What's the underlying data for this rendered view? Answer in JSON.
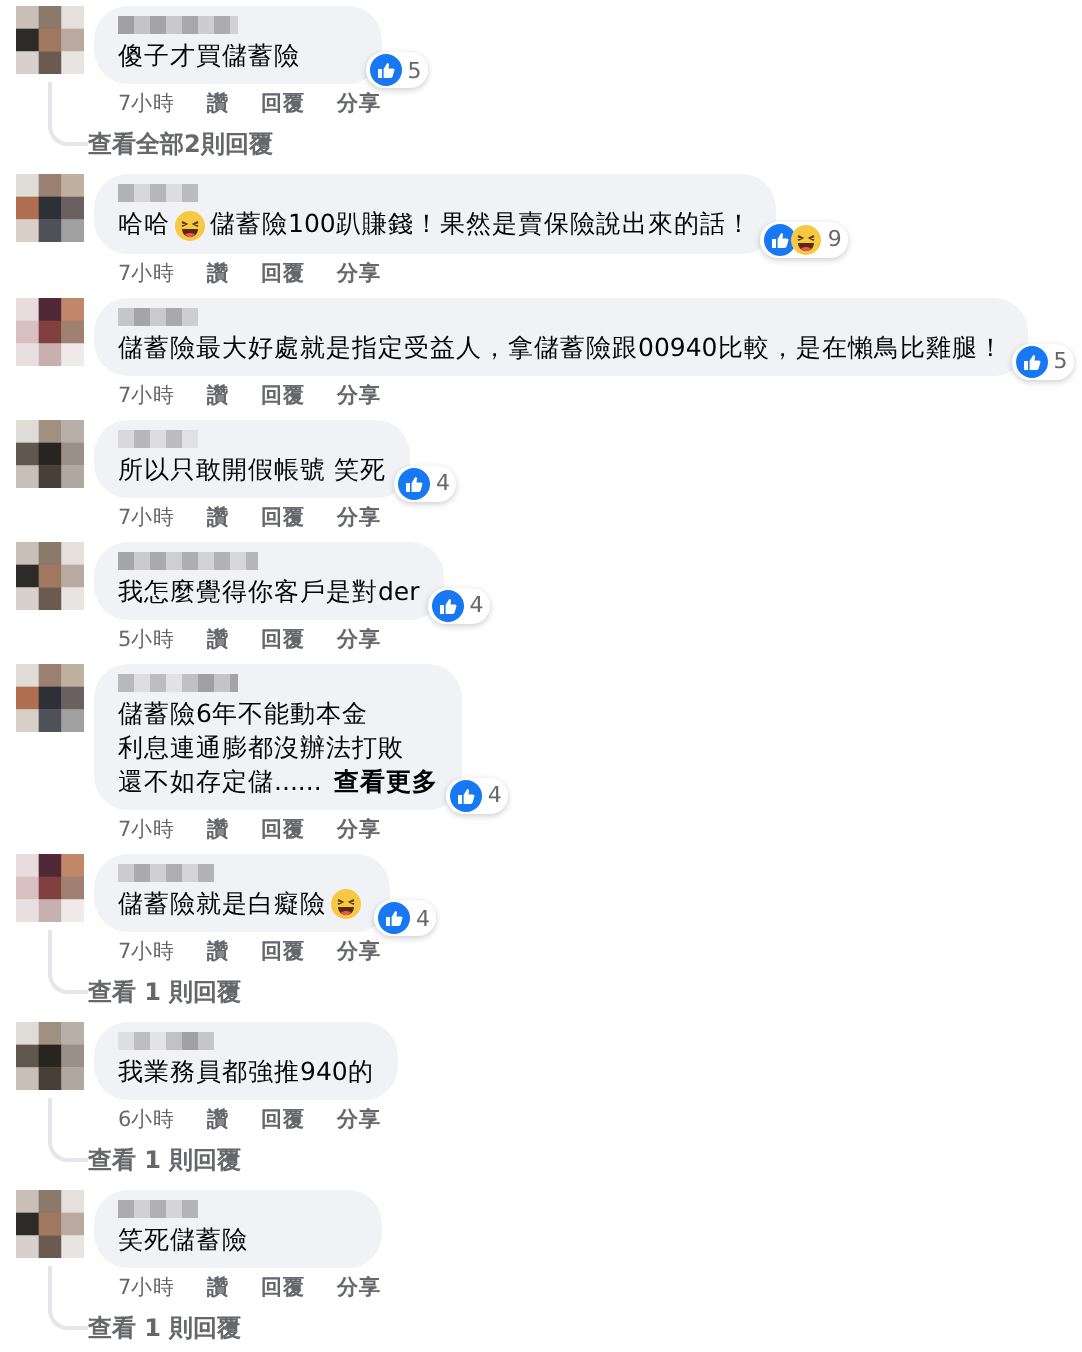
{
  "comments": [
    {
      "body": [
        {
          "kind": "text",
          "text": "傻子才買儲蓄險"
        }
      ],
      "reactions": {
        "icons": [
          {
            "kind": "like"
          }
        ],
        "count": "5"
      },
      "time": "7小時",
      "actions": [
        "讚",
        "回覆",
        "分享"
      ],
      "replies_link": "查看全部2則回覆"
    },
    {
      "body": [
        {
          "kind": "text",
          "text": "哈哈"
        },
        {
          "kind": "emoji"
        },
        {
          "kind": "text",
          "text": "儲蓄險100趴賺錢！果然是賣保險說出來的話！"
        }
      ],
      "reactions": {
        "icons": [
          {
            "kind": "like"
          },
          {
            "kind": "haha"
          }
        ],
        "count": "9"
      },
      "time": "7小時",
      "actions": [
        "讚",
        "回覆",
        "分享"
      ]
    },
    {
      "body": [
        {
          "kind": "text",
          "text": "儲蓄險最大好處就是指定受益人，拿儲蓄險跟00940比較，是在懶鳥比雞腿！"
        }
      ],
      "reactions": {
        "icons": [
          {
            "kind": "like"
          }
        ],
        "count": "5"
      },
      "time": "7小時",
      "actions": [
        "讚",
        "回覆",
        "分享"
      ]
    },
    {
      "body": [
        {
          "kind": "text",
          "text": "所以只敢開假帳號 笑死"
        }
      ],
      "reactions": {
        "icons": [
          {
            "kind": "like"
          }
        ],
        "count": "4"
      },
      "time": "7小時",
      "actions": [
        "讚",
        "回覆",
        "分享"
      ]
    },
    {
      "body": [
        {
          "kind": "text",
          "text": "我怎麼覺得你客戶是對der"
        }
      ],
      "reactions": {
        "icons": [
          {
            "kind": "like"
          }
        ],
        "count": "4"
      },
      "time": "5小時",
      "actions": [
        "讚",
        "回覆",
        "分享"
      ]
    },
    {
      "body": [
        {
          "kind": "line",
          "text": "儲蓄險6年不能動本金"
        },
        {
          "kind": "line",
          "text": "利息連通膨都沒辦法打敗"
        },
        {
          "kind": "line",
          "text": "還不如存定儲......"
        }
      ],
      "see_more": "查看更多",
      "reactions": {
        "icons": [
          {
            "kind": "like"
          }
        ],
        "count": "4"
      },
      "time": "7小時",
      "actions": [
        "讚",
        "回覆",
        "分享"
      ]
    },
    {
      "body": [
        {
          "kind": "text",
          "text": "儲蓄險就是白癡險"
        },
        {
          "kind": "emoji"
        }
      ],
      "reactions": {
        "icons": [
          {
            "kind": "like"
          }
        ],
        "count": "4"
      },
      "time": "7小時",
      "actions": [
        "讚",
        "回覆",
        "分享"
      ],
      "replies_link": "查看 1 則回覆"
    },
    {
      "body": [
        {
          "kind": "text",
          "text": "我業務員都強推940的"
        }
      ],
      "time": "6小時",
      "actions": [
        "讚",
        "回覆",
        "分享"
      ],
      "replies_link": "查看 1 則回覆"
    },
    {
      "body": [
        {
          "kind": "text",
          "text": "笑死儲蓄險"
        }
      ],
      "time": "7小時",
      "actions": [
        "讚",
        "回覆",
        "分享"
      ],
      "replies_link": "查看 1 則回覆"
    }
  ]
}
